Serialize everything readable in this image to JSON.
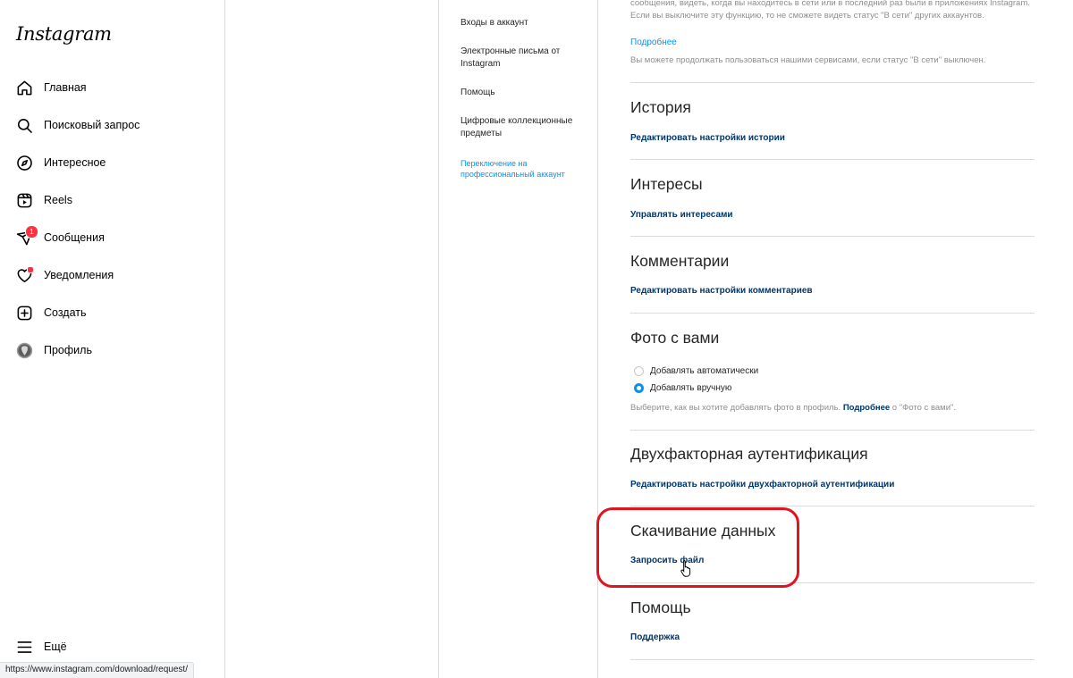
{
  "brand": {
    "logo": "Instagram"
  },
  "nav": {
    "home": "Главная",
    "search": "Поисковый запрос",
    "explore": "Интересное",
    "reels": "Reels",
    "messages": "Сообщения",
    "messages_badge": "1",
    "notifications": "Уведомления",
    "create": "Создать",
    "profile": "Профиль",
    "more": "Ещё"
  },
  "statusbar": {
    "url": "https://www.instagram.com/download/request/"
  },
  "settings_menu": [
    "Входы в аккаунт",
    "Электронные письма от Instagram",
    "Помощь",
    "Цифровые коллекционные предметы",
    "Переключение на профессиональный аккаунт"
  ],
  "activity": {
    "desc": "сообщения, видеть, когда вы находитесь в сети или в последний раз были в приложениях Instagram. Если вы выключите эту функцию, то не сможете видеть статус \"В сети\" других аккаунтов.",
    "more_link": "Подробнее",
    "note": "Вы можете продолжать пользоваться нашими сервисами, если статус \"В сети\" выключен."
  },
  "sections": {
    "story": {
      "title": "История",
      "link": "Редактировать настройки истории"
    },
    "interests": {
      "title": "Интересы",
      "link": "Управлять интересами"
    },
    "comments": {
      "title": "Комментарии",
      "link": "Редактировать настройки комментариев"
    },
    "photos": {
      "title": "Фото с вами",
      "option_auto": "Добавлять автоматически",
      "option_manual": "Добавлять вручную",
      "selected": "option_manual",
      "note_before": "Выберите, как вы хотите добавлять фото в профиль. ",
      "note_link": "Подробнее",
      "note_after": " о \"Фото с вами\"."
    },
    "twofactor": {
      "title": "Двухфакторная аутентификация",
      "link": "Редактировать настройки двухфакторной аутентификации"
    },
    "download": {
      "title": "Скачивание данных",
      "link": "Запросить файл"
    },
    "help": {
      "title": "Помощь",
      "link": "Поддержка"
    }
  },
  "colors": {
    "link_blue": "#0095f6",
    "link_dark": "#00376b",
    "highlight": "#e0141f",
    "badge": "#ff3040"
  }
}
